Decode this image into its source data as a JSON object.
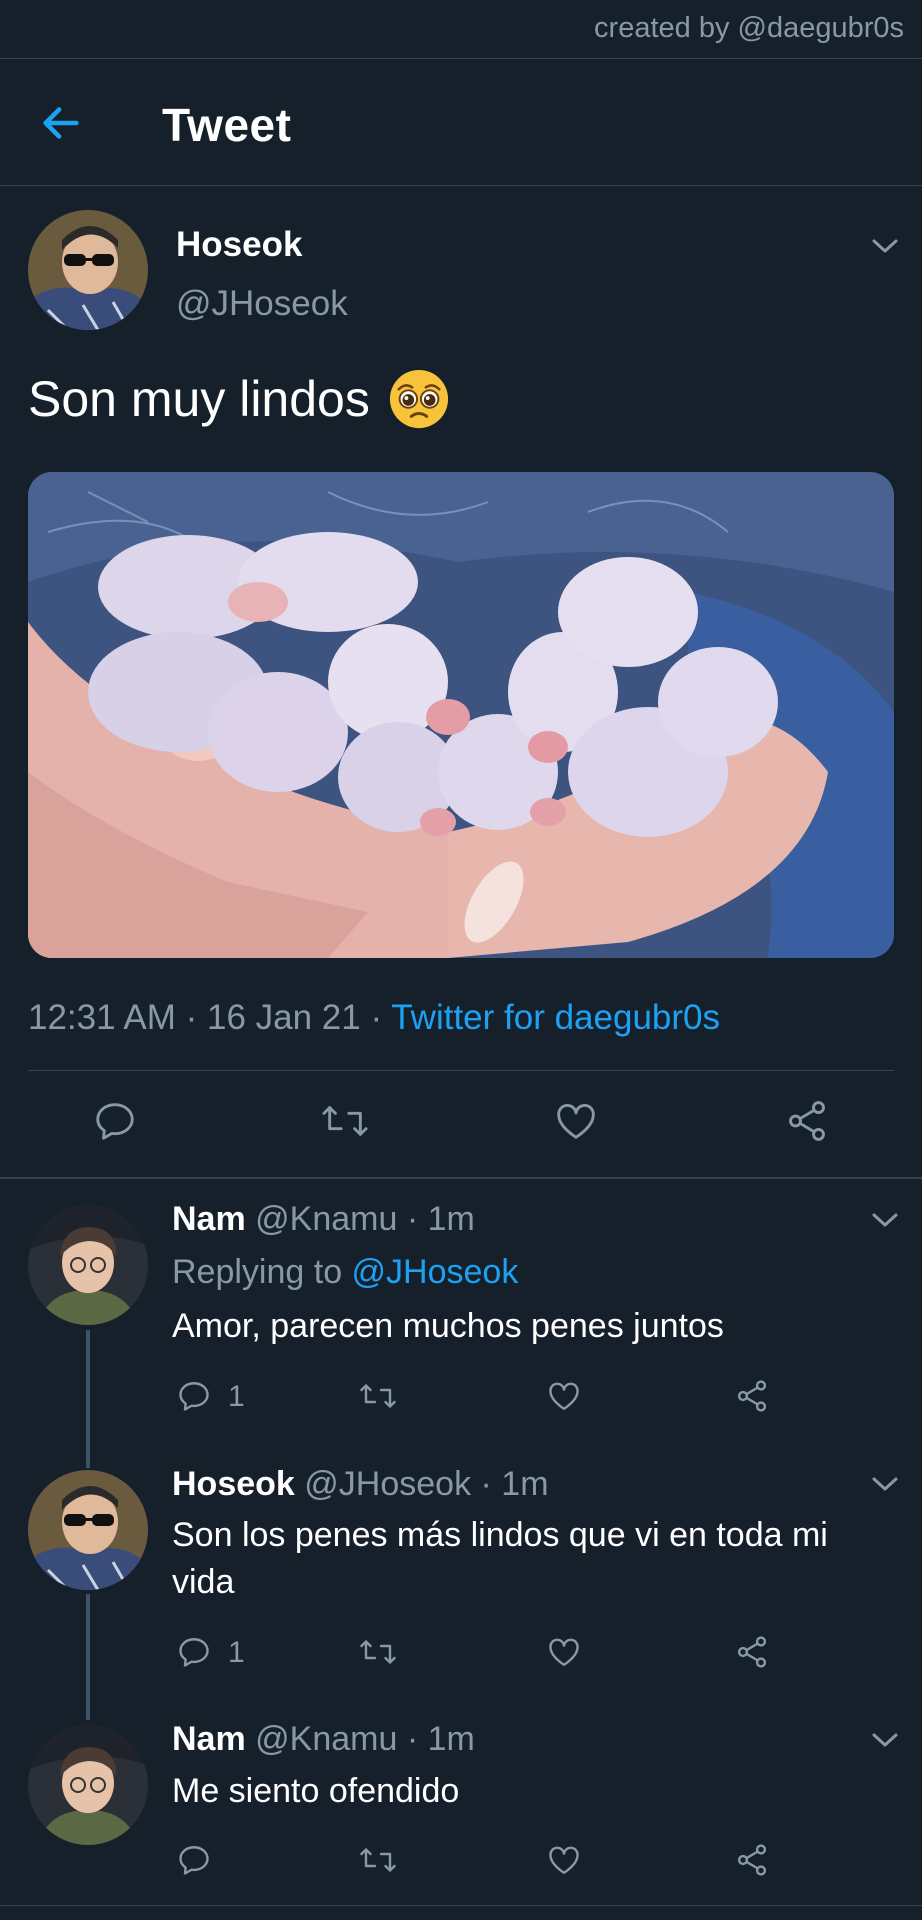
{
  "credit": "created by @daegubr0s",
  "header": {
    "title": "Tweet"
  },
  "main_tweet": {
    "name": "Hoseok",
    "handle": "@JHoseok",
    "text": "Son muy lindos",
    "time": "12:31 AM",
    "date": "16 Jan 21",
    "source": "Twitter for daegubr0s",
    "sep": " · "
  },
  "replies": [
    {
      "name": "Nam",
      "handle": "@Knamu · 1m",
      "replying_prefix": "Replying to ",
      "replying_handle": "@JHoseok",
      "text": "Amor, parecen muchos penes juntos",
      "reply_count": "1"
    },
    {
      "name": "Hoseok",
      "handle": "@JHoseok · 1m",
      "text": "Son los penes más lindos que vi en toda mi vida",
      "reply_count": "1"
    },
    {
      "name": "Nam",
      "handle": "@Knamu · 1m",
      "text": "Me siento ofendido"
    }
  ],
  "icons": {
    "back": "arrow-left-icon",
    "reply": "speech-bubble-icon",
    "retweet": "retweet-icon",
    "like": "heart-icon",
    "share": "share-icon",
    "chevron": "chevron-down-icon"
  },
  "colors": {
    "background": "#15202b",
    "accent": "#1da1f2",
    "secondary_text": "#8899a6",
    "divider": "#38444d"
  }
}
